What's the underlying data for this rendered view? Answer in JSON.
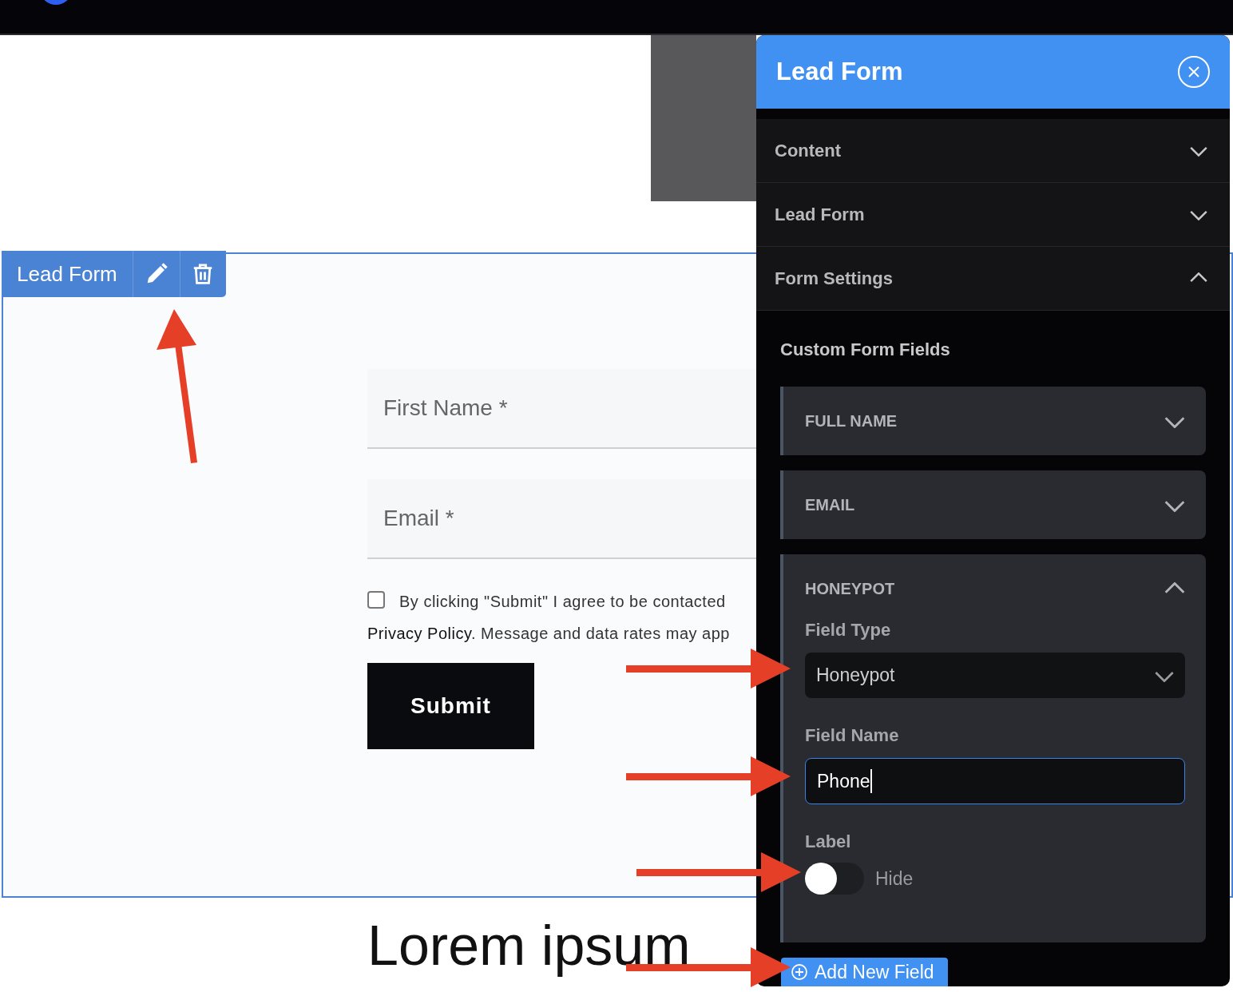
{
  "toolbar": {
    "label": "Lead Form"
  },
  "form": {
    "fields": [
      {
        "placeholder": "First Name *"
      },
      {
        "placeholder": "Email *"
      }
    ],
    "consent": {
      "checked": false,
      "line_1": "By clicking \"Submit\" I agree to be contacted",
      "line_2": "**Privacy Policy**. Message and data rates may app"
    },
    "submit": "Submit"
  },
  "heading": "Lorem ipsum",
  "panel": {
    "title": "Lead Form",
    "sections": [
      {
        "label": "Content",
        "expanded": false
      },
      {
        "label": "Lead Form",
        "expanded": false
      },
      {
        "label": "Form Settings",
        "expanded": true
      }
    ],
    "subheading": "Custom Form Fields",
    "fields": [
      {
        "title": "FULL NAME",
        "expanded": false
      },
      {
        "title": "EMAIL",
        "expanded": false
      },
      {
        "title": "HONEYPOT",
        "expanded": true,
        "field_type_label": "Field Type",
        "field_type": "Honeypot",
        "field_name_label": "Field Name",
        "field_name": "Phone",
        "label_label": "Label",
        "label_toggle": {
          "on": false,
          "text": "Hide"
        }
      }
    ],
    "add_button": "Add New Field"
  }
}
